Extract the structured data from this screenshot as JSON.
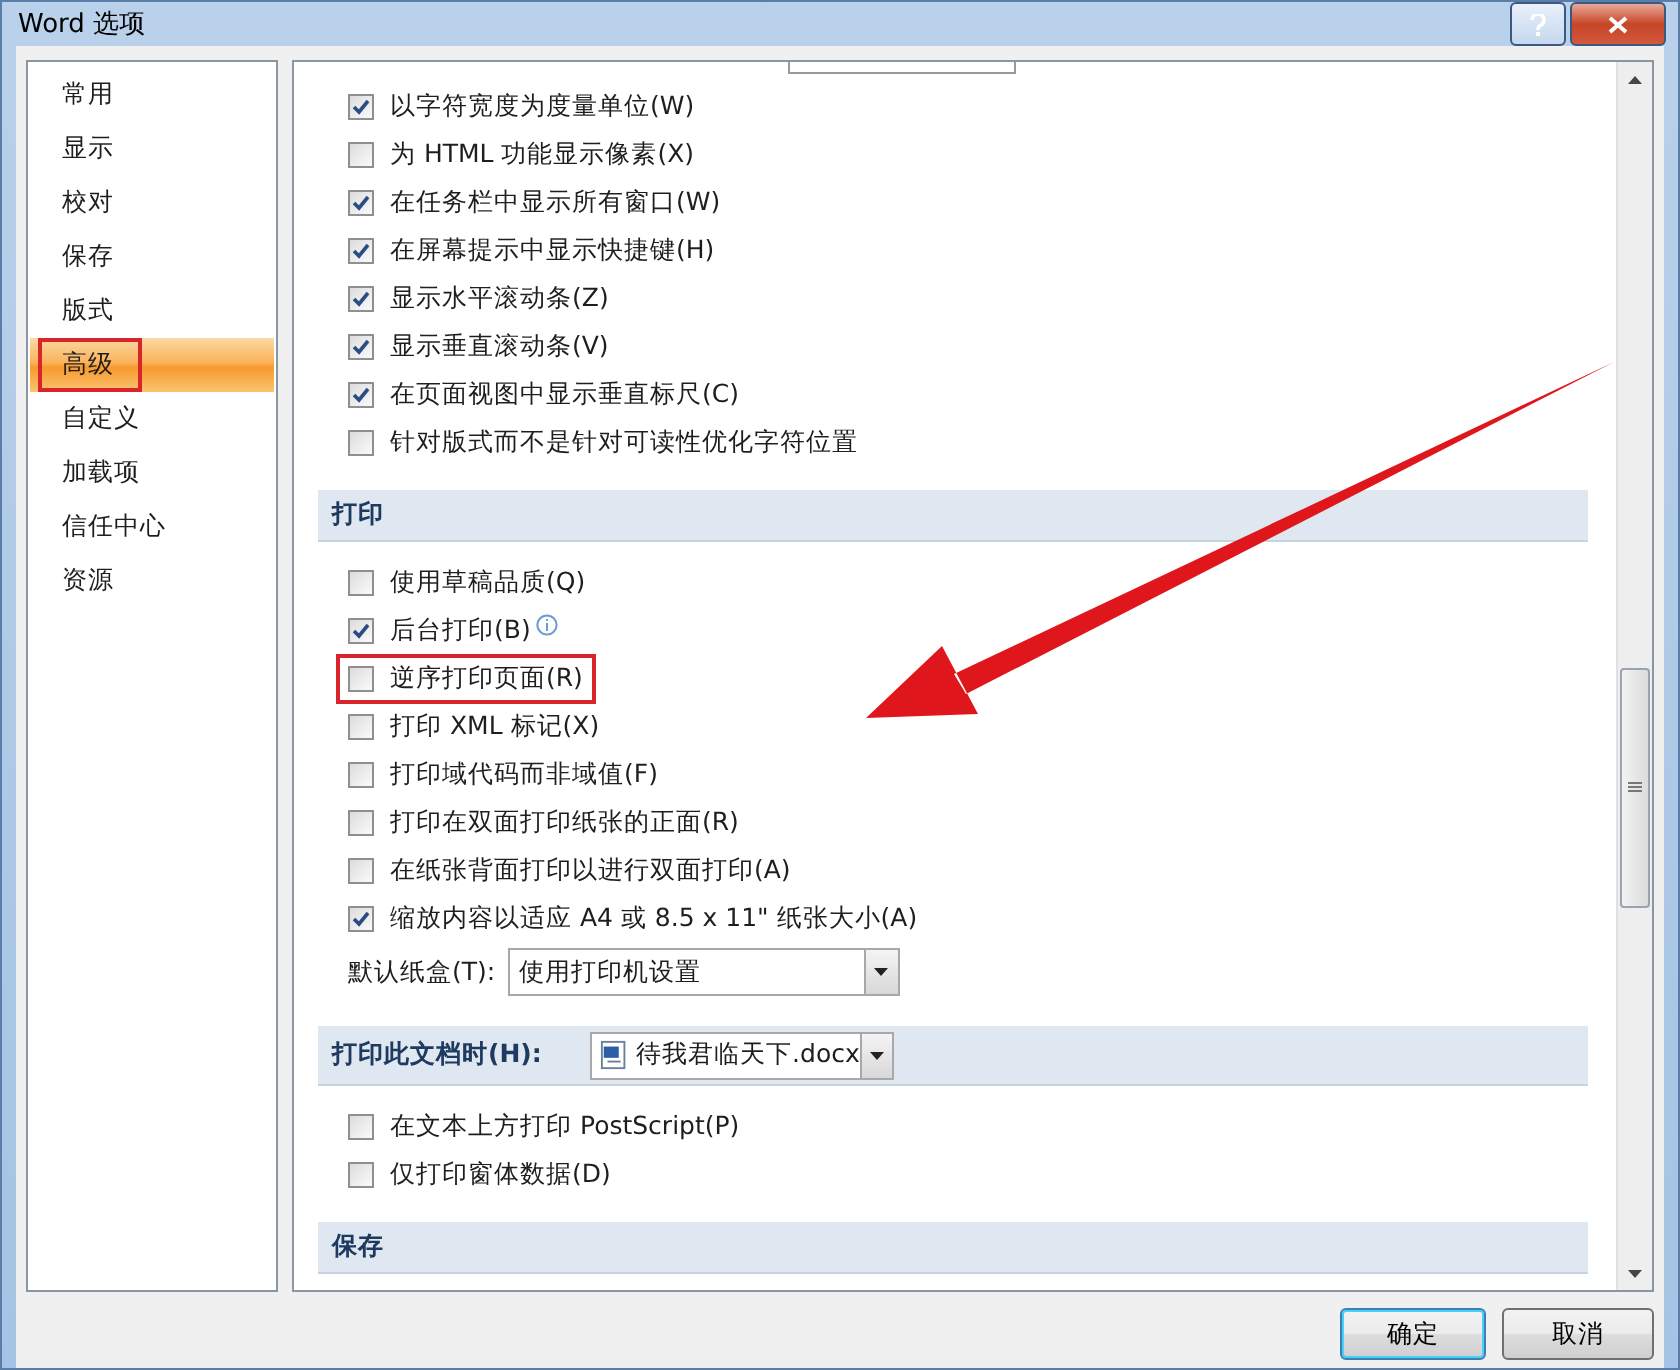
{
  "window": {
    "title": "Word 选项"
  },
  "sidebar": {
    "items": [
      {
        "label": "常用",
        "selected": false,
        "annotated": false
      },
      {
        "label": "显示",
        "selected": false,
        "annotated": false
      },
      {
        "label": "校对",
        "selected": false,
        "annotated": false
      },
      {
        "label": "保存",
        "selected": false,
        "annotated": false
      },
      {
        "label": "版式",
        "selected": false,
        "annotated": false
      },
      {
        "label": "高级",
        "selected": true,
        "annotated": true
      },
      {
        "label": "自定义",
        "selected": false,
        "annotated": false
      },
      {
        "label": "加载项",
        "selected": false,
        "annotated": false
      },
      {
        "label": "信任中心",
        "selected": false,
        "annotated": false
      },
      {
        "label": "资源",
        "selected": false,
        "annotated": false
      }
    ]
  },
  "content": [
    {
      "kind": "checkbox",
      "label": "以字符宽度为度量单位(W)",
      "checked": true,
      "info": false,
      "annotated": false
    },
    {
      "kind": "checkbox",
      "label": "为 HTML 功能显示像素(X)",
      "checked": false,
      "info": false,
      "annotated": false
    },
    {
      "kind": "checkbox",
      "label": "在任务栏中显示所有窗口(W)",
      "checked": true,
      "info": false,
      "annotated": false
    },
    {
      "kind": "checkbox",
      "label": "在屏幕提示中显示快捷键(H)",
      "checked": true,
      "info": false,
      "annotated": false
    },
    {
      "kind": "checkbox",
      "label": "显示水平滚动条(Z)",
      "checked": true,
      "info": false,
      "annotated": false
    },
    {
      "kind": "checkbox",
      "label": "显示垂直滚动条(V)",
      "checked": true,
      "info": false,
      "annotated": false
    },
    {
      "kind": "checkbox",
      "label": "在页面视图中显示垂直标尺(C)",
      "checked": true,
      "info": false,
      "annotated": false
    },
    {
      "kind": "checkbox",
      "label": "针对版式而不是针对可读性优化字符位置",
      "checked": false,
      "info": false,
      "annotated": false
    },
    {
      "kind": "header",
      "label": "打印"
    },
    {
      "kind": "checkbox",
      "label": "使用草稿品质(Q)",
      "checked": false,
      "info": false,
      "annotated": false
    },
    {
      "kind": "checkbox",
      "label": "后台打印(B)",
      "checked": true,
      "info": true,
      "annotated": false
    },
    {
      "kind": "checkbox",
      "label": "逆序打印页面(R)",
      "checked": false,
      "info": false,
      "annotated": true
    },
    {
      "kind": "checkbox",
      "label": "打印 XML 标记(X)",
      "checked": false,
      "info": false,
      "annotated": false
    },
    {
      "kind": "checkbox",
      "label": "打印域代码而非域值(F)",
      "checked": false,
      "info": false,
      "annotated": false
    },
    {
      "kind": "checkbox",
      "label": "打印在双面打印纸张的正面(R)",
      "checked": false,
      "info": false,
      "annotated": false
    },
    {
      "kind": "checkbox",
      "label": "在纸张背面打印以进行双面打印(A)",
      "checked": false,
      "info": false,
      "annotated": false
    },
    {
      "kind": "checkbox",
      "label": "缩放内容以适应 A4 或 8.5 x 11\" 纸张大小(A)",
      "checked": true,
      "info": false,
      "annotated": false
    },
    {
      "kind": "select",
      "label": "默认纸盒(T):",
      "value": "使用打印机设置"
    },
    {
      "kind": "doc_header",
      "label": "打印此文档时(H):",
      "value": "待我君临天下.docx"
    },
    {
      "kind": "checkbox",
      "label": "在文本上方打印 PostScript(P)",
      "checked": false,
      "info": false,
      "annotated": false
    },
    {
      "kind": "checkbox",
      "label": "仅打印窗体数据(D)",
      "checked": false,
      "info": false,
      "annotated": false
    },
    {
      "kind": "header",
      "label": "保存"
    }
  ],
  "buttons": [
    {
      "label": "确定",
      "default": true
    },
    {
      "label": "取消",
      "default": false
    }
  ]
}
